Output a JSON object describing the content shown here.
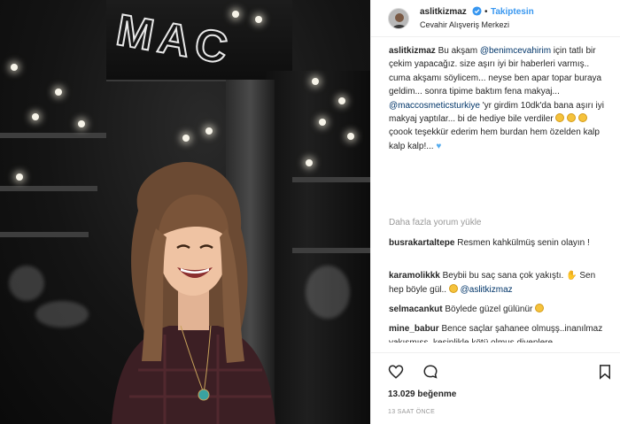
{
  "header": {
    "username": "aslitkizmaz",
    "follow_status": "Takiptesin",
    "location": "Cevahir Alışveriş Merkezi",
    "separator": "•"
  },
  "photo": {
    "store_logo_text": "MAC"
  },
  "caption": {
    "username": "aslitkizmaz",
    "t1": " Bu akşam ",
    "m1": "@benimcevahirim",
    "t2": " için tatlı bir çekim yapacağız. size aşırı iyi bir haberleri varmış.. cuma akşamı söylicem... neyse ben apar topar buraya geldim... sonra tipime baktım fena makyaj... ",
    "m2": "@maccosmeticsturkiye",
    "t3": " 'yr girdim 10dk'da bana aşırı iyi makyaj yaptılar... bi de hediye bile verdiler ",
    "t4": " çoook teşekkür ederim hem burdan hem özelden kalp kalp kalp!... "
  },
  "load_more": "Daha fazla yorum yükle",
  "comments": [
    {
      "username": "busrakartaltepe",
      "text": " Resmen kahkülmüş senin olayın !"
    },
    {
      "username": "karamolikkk",
      "text": " Beybii bu saç sana çok yakıştı. ",
      "text2": " Sen hep böyle gül.. ",
      "mention": "@aslitkizmaz"
    },
    {
      "username": "selmacankut",
      "text": " Böylede güzel gülünür "
    },
    {
      "username": "mine_babur",
      "text": " Bence saçlar şahanee olmuşş..inanılmaz yakışmışş..kesinlikle kötü olmuş diyenlere takılmayın..cumya sadece"
    }
  ],
  "likes": "13.029 beğenme",
  "time": "13 SAAT ÖNCE",
  "icons": {
    "verified": "verified-badge-icon",
    "like": "heart-icon",
    "comment": "comment-bubble-icon",
    "save": "bookmark-icon"
  },
  "colors": {
    "accent": "#3897f0",
    "mention": "#003569",
    "muted": "#999999"
  }
}
